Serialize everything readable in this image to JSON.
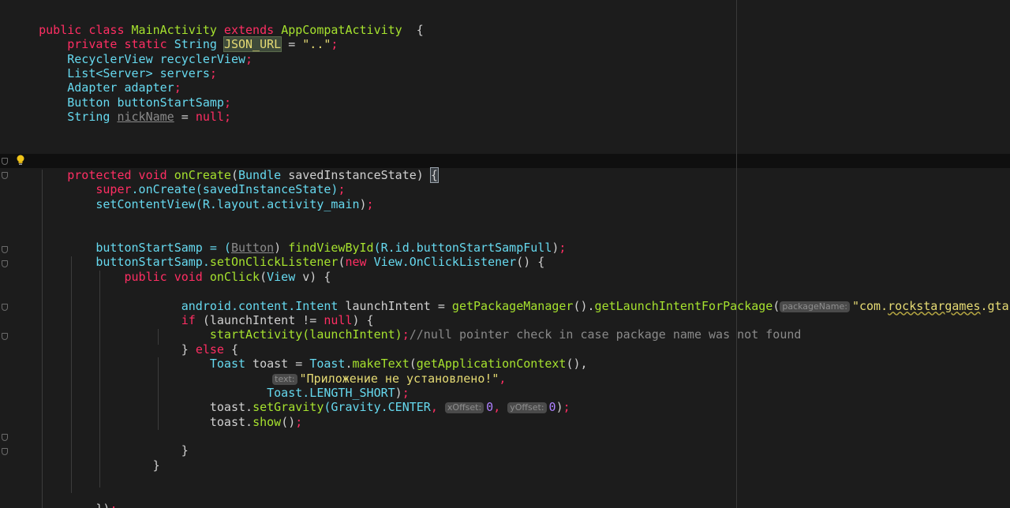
{
  "editor": {
    "line1_a": "public class ",
    "line1_b": "MainActivity",
    "line1_c": " extends ",
    "line1_d": "AppCompatActivity",
    "line1_e": "  {",
    "line2_a": "    private static ",
    "line2_b": "String",
    "line2_c": "JSON_URL",
    "line2_d": " = ",
    "line2_e": "\"..\"",
    "line2_f": ";",
    "line3_a": "    RecyclerView",
    "line3_b": " recyclerView",
    "line3_c": ";",
    "line4_a": "    List<",
    "line4_b": "Server",
    "line4_c": "> servers",
    "line4_d": ";",
    "line5_a": "    Adapter",
    "line5_b": " adapter",
    "line5_c": ";",
    "line6_a": "    Button",
    "line6_b": " buttonStartSamp",
    "line6_c": ";",
    "line7_a": "    String",
    "line7_b": "nickName",
    "line7_c": " = ",
    "line7_d": "null",
    "line7_e": ";",
    "line8_a": "    protected void ",
    "line8_b": "onCreate",
    "line8_c": "(",
    "line8_d": "Bundle",
    "line8_e": " savedInstanceState) ",
    "line8_f": "{",
    "line9_a": "        super",
    "line9_b": ".onCreate(savedInstanceState)",
    "line9_c": ";",
    "line10_a": "        setContentView(R.layout.",
    "line10_b": "activity_main",
    "line10_c": ")",
    "line10_d": ";",
    "line11_a": "        buttonStartSamp = (",
    "line11_b": "Button",
    "line11_c": ") ",
    "line11_d": "findViewById",
    "line11_e": "(R.id.",
    "line11_f": "buttonStartSampFull",
    "line11_g": ")",
    "line11_h": ";",
    "line12_a": "        buttonStartSamp.",
    "line12_b": "setOnClickListener",
    "line12_c": "(",
    "line12_d": "new ",
    "line12_e": "View.OnClickListener",
    "line12_f": "() {",
    "line13_a": "            public void ",
    "line13_b": "onClick",
    "line13_c": "(",
    "line13_d": "View",
    "line13_e": " v) {",
    "line14_a": "                    android.content.",
    "line14_b": "Intent",
    "line14_c": " launchIntent = ",
    "line14_d": "getPackageManager",
    "line14_e": "().",
    "line14_f": "getLaunchIntentForPackage",
    "line14_g": "(",
    "line14_hint": "packageName:",
    "line14_h": "\"com.",
    "line14_i": "rockstargames",
    "line14_j": ".gta",
    "line15_a": "                    if",
    "line15_b": " (launchIntent != ",
    "line15_c": "null",
    "line15_d": ") {",
    "line16_a": "                        startActivity(launchIntent)",
    "line16_b": ";",
    "line16_c": "//null pointer check in case package name was not found",
    "line17_a": "                    } ",
    "line17_b": "else",
    "line17_c": " {",
    "line18_a": "                        Toast",
    "line18_b": " toast = ",
    "line18_c": "Toast",
    "line18_d": ".",
    "line18_e": "makeText",
    "line18_f": "(",
    "line18_g": "getApplicationContext",
    "line18_h": "(),",
    "line19_hint": "text:",
    "line19_a": "\"Приложение не установлено!\"",
    "line19_b": ",",
    "line20_a": "                                Toast.",
    "line20_b": "LENGTH_SHORT",
    "line20_c": ")",
    "line20_d": ";",
    "line21_a": "                        toast.",
    "line21_b": "setGravity",
    "line21_c": "(Gravity.",
    "line21_d": "CENTER",
    "line21_e": ", ",
    "line21_hint1": "xOffset:",
    "line21_f": "0",
    "line21_g": ", ",
    "line21_hint2": "yOffset:",
    "line21_h": "0",
    "line21_i": ")",
    "line21_j": ";",
    "line22_a": "                        toast.",
    "line22_b": "show",
    "line22_c": "()",
    "line22_d": ";",
    "line23": "                    }",
    "line24": "                }",
    "line25_a": "        })",
    "line25_b": ";"
  },
  "colors": {
    "keyword": "#ff2e63",
    "type": "#66d9ef",
    "function": "#a6e22e",
    "string": "#e6db74",
    "comment": "#8a8a8a",
    "background": "#1c1c1c"
  },
  "icons": [
    "fold-marker-icon",
    "lightbulb-icon"
  ]
}
